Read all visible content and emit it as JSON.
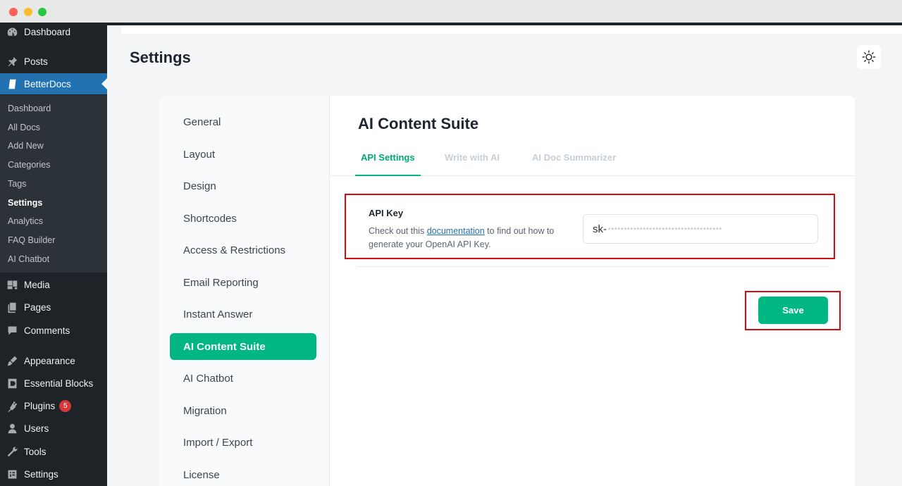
{
  "sidebar": {
    "items": [
      {
        "label": "Dashboard",
        "icon": "dashboard-icon"
      },
      {
        "label": "Posts",
        "icon": "pin-icon"
      },
      {
        "label": "BetterDocs",
        "icon": "docs-icon"
      },
      {
        "label": "Media",
        "icon": "media-icon"
      },
      {
        "label": "Pages",
        "icon": "pages-icon"
      },
      {
        "label": "Comments",
        "icon": "comments-icon"
      },
      {
        "label": "Appearance",
        "icon": "brush-icon"
      },
      {
        "label": "Essential Blocks",
        "icon": "blocks-icon"
      },
      {
        "label": "Plugins",
        "icon": "plugin-icon",
        "badge": "5"
      },
      {
        "label": "Users",
        "icon": "users-icon"
      },
      {
        "label": "Tools",
        "icon": "wrench-icon"
      },
      {
        "label": "Settings",
        "icon": "settings-icon"
      }
    ],
    "submenu": [
      "Dashboard",
      "All Docs",
      "Add New",
      "Categories",
      "Tags",
      "Settings",
      "Analytics",
      "FAQ Builder",
      "AI Chatbot"
    ]
  },
  "page": {
    "title": "Settings"
  },
  "settings_nav": [
    "General",
    "Layout",
    "Design",
    "Shortcodes",
    "Access & Restrictions",
    "Email Reporting",
    "Instant Answer",
    "AI Content Suite",
    "AI Chatbot",
    "Migration",
    "Import / Export",
    "License"
  ],
  "content": {
    "title": "AI Content Suite",
    "tabs": [
      "API Settings",
      "Write with AI",
      "AI Doc Summarizer"
    ],
    "api": {
      "label": "API Key",
      "desc_prefix": "Check out this ",
      "desc_link": "documentation",
      "desc_suffix": " to find out how to generate your OpenAI API Key.",
      "value_prefix": "sk-",
      "value_masked": "••••••••••••••••••••••••••••••••••••"
    },
    "save_label": "Save"
  },
  "colors": {
    "accent": "#00b682",
    "wp_blue": "#2271b1",
    "highlight": "#d40b12"
  }
}
